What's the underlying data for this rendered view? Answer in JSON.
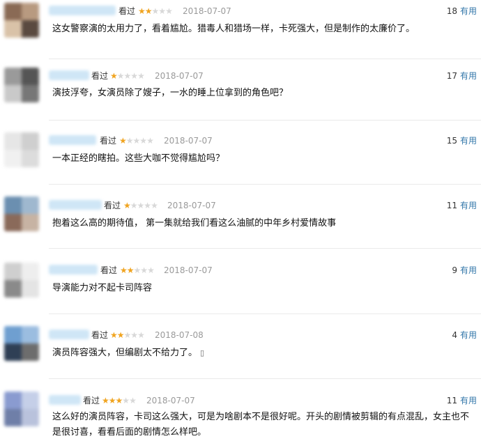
{
  "reviews": [
    {
      "watched_label": "看过",
      "rating": 2,
      "date": "2018-07-07",
      "votes": "18",
      "useful_label": "有用",
      "content": "这女警察演的太用力了，看着尴尬。猎毒人和猎场一样，卡死强大，但是制作的太廉价了。",
      "avatar_colors": [
        "#8a6a55",
        "#b89a80",
        "#d9c2a8",
        "#5a4a40"
      ]
    },
    {
      "watched_label": "看过",
      "rating": 1,
      "date": "2018-07-07",
      "votes": "17",
      "useful_label": "有用",
      "content": "演技浮夸，女演员除了嫂子，一水的睡上位拿到的角色吧？",
      "avatar_colors": [
        "#9a9a9a",
        "#555555",
        "#c9c9c9",
        "#777777"
      ]
    },
    {
      "watched_label": "看过",
      "rating": 1,
      "date": "2018-07-07",
      "votes": "15",
      "useful_label": "有用",
      "content": "一本正经的瞎拍。这些大咖不觉得尴尬吗？",
      "avatar_colors": [
        "#e6e6e6",
        "#cfcfcf",
        "#f0f0f0",
        "#dcdcdc"
      ]
    },
    {
      "watched_label": "看过",
      "rating": 1,
      "date": "2018-07-07",
      "votes": "11",
      "useful_label": "有用",
      "content": "抱着这么高的期待值， 第一集就给我们看这么油腻的中年乡村爱情故事",
      "avatar_colors": [
        "#6b8fb0",
        "#9fb8cf",
        "#8a6a5a",
        "#c7b3a3"
      ]
    },
    {
      "watched_label": "看过",
      "rating": 2,
      "date": "2018-07-07",
      "votes": "9",
      "useful_label": "有用",
      "content": "导演能力对不起卡司阵容",
      "avatar_colors": [
        "#cfcfcf",
        "#eeeeee",
        "#8a8a8a",
        "#e4e4e4"
      ]
    },
    {
      "watched_label": "看过",
      "rating": 2,
      "date": "2018-07-08",
      "votes": "4",
      "useful_label": "有用",
      "content": "演员阵容强大，但编剧太不给力了。",
      "avatar_colors": [
        "#6f9fd0",
        "#9bbde0",
        "#2f3f55",
        "#6d6d6d"
      ]
    },
    {
      "watched_label": "看过",
      "rating": 3,
      "date": "2018-07-07",
      "votes": "11",
      "useful_label": "有用",
      "content": "这么好的演员阵容，卡司这么强大，可是为啥剧本不是很好呢。开头的剧情被剪辑的有点混乱，女主也不是很讨喜，看看后面的剧情怎么样吧。",
      "avatar_colors": [
        "#8a9bd0",
        "#c5cfe8",
        "#6f7fa8",
        "#b9c2dc"
      ]
    }
  ],
  "icons": {
    "star": "★",
    "mobile": "mobile-icon"
  }
}
